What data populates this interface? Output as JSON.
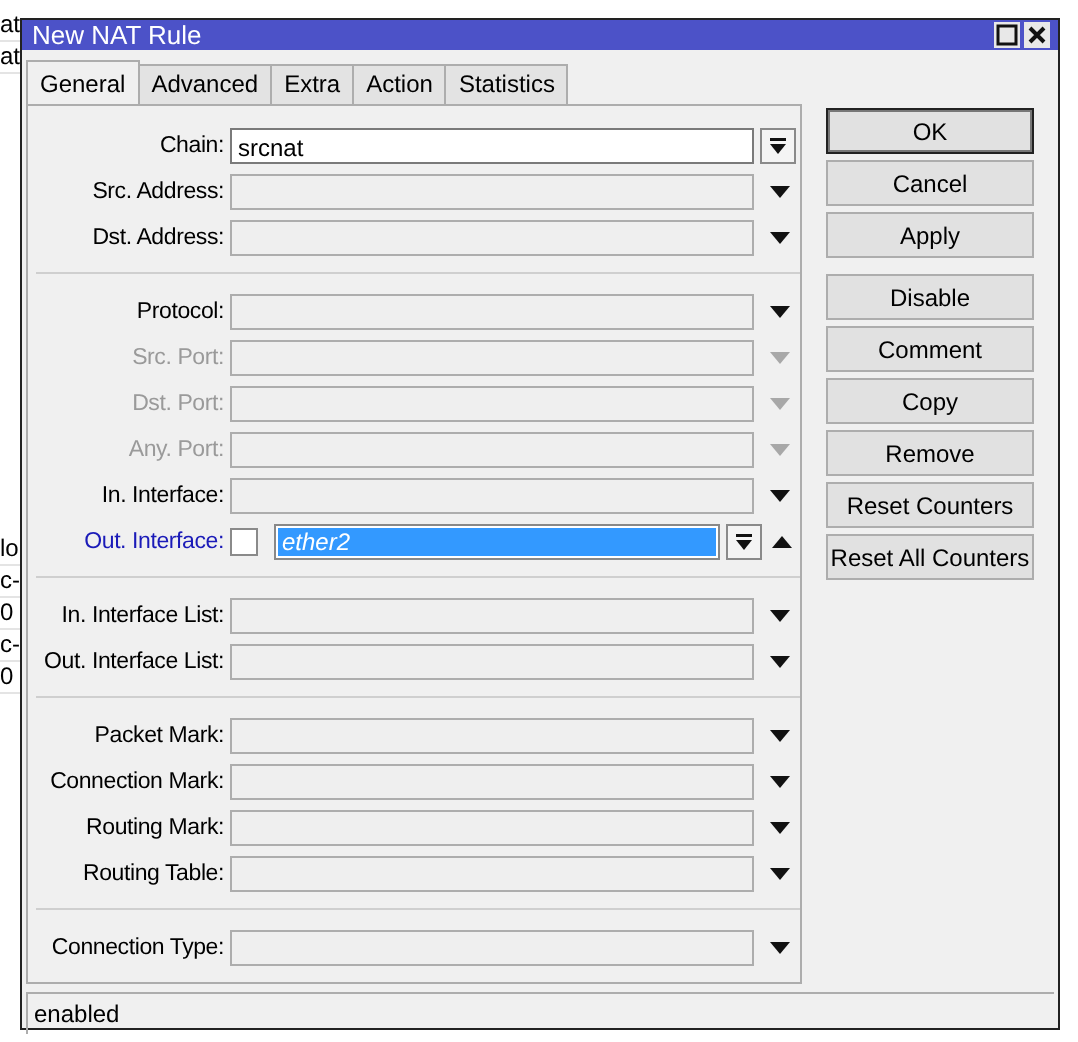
{
  "background": {
    "top": [
      "at",
      "at"
    ],
    "middle": [
      "lo",
      "c-",
      "0",
      "c-",
      "0"
    ]
  },
  "window": {
    "title": "New NAT Rule"
  },
  "tabs": [
    {
      "label": "General",
      "selected": true
    },
    {
      "label": "Advanced",
      "selected": false
    },
    {
      "label": "Extra",
      "selected": false
    },
    {
      "label": "Action",
      "selected": false
    },
    {
      "label": "Statistics",
      "selected": false
    }
  ],
  "groups": [
    {
      "rows": [
        {
          "label": "Chain:",
          "kind": "combo",
          "value": "srcnat",
          "disabled": false
        },
        {
          "label": "Src. Address:",
          "kind": "dropdown",
          "disabled": false
        },
        {
          "label": "Dst. Address:",
          "kind": "dropdown",
          "disabled": false
        }
      ]
    },
    {
      "rows": [
        {
          "label": "Protocol:",
          "kind": "dropdown",
          "disabled": false
        },
        {
          "label": "Src. Port:",
          "kind": "dropdown",
          "disabled": true
        },
        {
          "label": "Dst. Port:",
          "kind": "dropdown",
          "disabled": true
        },
        {
          "label": "Any. Port:",
          "kind": "dropdown",
          "disabled": true
        },
        {
          "label": "In. Interface:",
          "kind": "dropdown",
          "disabled": false
        },
        {
          "label": "Out. Interface:",
          "kind": "negatable",
          "value": "ether2",
          "disabled": false,
          "focused": true,
          "negated": false,
          "value_selected": true,
          "expanded": true
        }
      ]
    },
    {
      "rows": [
        {
          "label": "In. Interface List:",
          "kind": "dropdown",
          "disabled": false
        },
        {
          "label": "Out. Interface List:",
          "kind": "dropdown",
          "disabled": false
        }
      ]
    },
    {
      "rows": [
        {
          "label": "Packet Mark:",
          "kind": "dropdown",
          "disabled": false
        },
        {
          "label": "Connection Mark:",
          "kind": "dropdown",
          "disabled": false
        },
        {
          "label": "Routing Mark:",
          "kind": "dropdown",
          "disabled": false
        },
        {
          "label": "Routing Table:",
          "kind": "dropdown",
          "disabled": false
        }
      ]
    },
    {
      "rows": [
        {
          "label": "Connection Type:",
          "kind": "dropdown",
          "disabled": false
        }
      ]
    }
  ],
  "button_groups": [
    [
      {
        "label": "OK",
        "default": true
      },
      {
        "label": "Cancel",
        "default": false
      },
      {
        "label": "Apply",
        "default": false
      }
    ],
    [
      {
        "label": "Disable",
        "default": false
      },
      {
        "label": "Comment",
        "default": false
      },
      {
        "label": "Copy",
        "default": false
      },
      {
        "label": "Remove",
        "default": false
      },
      {
        "label": "Reset Counters",
        "default": false
      },
      {
        "label": "Reset All Counters",
        "default": false
      }
    ]
  ],
  "status_bar": "enabled"
}
